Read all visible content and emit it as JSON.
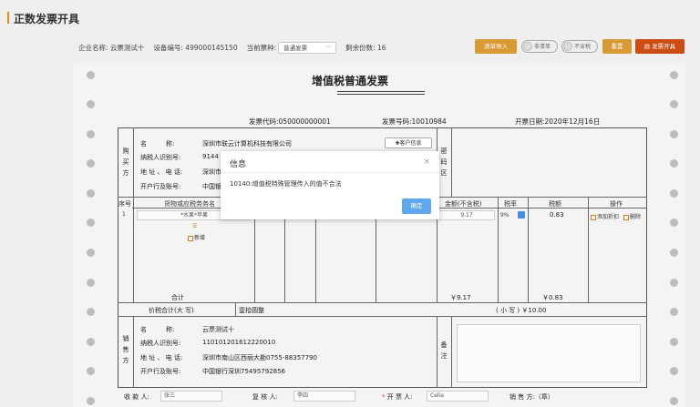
{
  "page_title": "正数发票开具",
  "toolbar": {
    "company_label": "企业名称: 云票测试十",
    "device_label": "设备编号: 499000145150",
    "current_type_label": "当前票种:",
    "current_type_value": "普通发票",
    "remaining_label": "剩余份数: 16",
    "btn_list_import": "清单导入",
    "toggle_list": "非清单",
    "toggle_tax": "不含税",
    "btn_reset": "重置",
    "btn_issue": "发票开具"
  },
  "invoice": {
    "title": "增值税普通发票",
    "code_label": "发票代码:050000000001",
    "number_label": "发票号码:10010984",
    "date_label": "开票日期:2020年12月16日",
    "buyer_side_label": [
      "购",
      "买",
      "方"
    ],
    "buyer": {
      "name_label": "名　　　称:",
      "name_value": "深圳市联云计算机科技有限公司",
      "taxid_label": "纳税人识别号:",
      "taxid_value": "9144",
      "addr_label": "地 址 、 电 话:",
      "addr_value": "深圳市",
      "bank_label": "开户行及账号:",
      "bank_value": "中国银",
      "customer_btn": "客户信息"
    },
    "password_area_label": [
      "密",
      "码",
      "区"
    ],
    "items_header": {
      "seq": "序号",
      "goods": "货物或应税劳务名",
      "amount": "金额(不含税)",
      "rate": "税率",
      "tax": "税额",
      "action": "操作"
    },
    "item_row": {
      "seq": "1",
      "goods": "*水果*苹果",
      "amount": "9.17",
      "rate": "9%",
      "tax": "0.83",
      "add_discount": "添加折扣",
      "delete": "删除"
    },
    "add_new": "新增",
    "total_label": "合计",
    "total_amount": "￥9.17",
    "total_tax": "￥0.83",
    "price_tax_total_label": "价税合计(大 写)",
    "price_tax_total_upper": "壹拾圆整",
    "price_tax_total_lower": "( 小 写 ) ￥10.00",
    "seller_side_label": [
      "销",
      "售",
      "方"
    ],
    "seller": {
      "name_label": "名　　　称:",
      "name_value": "云票测试十",
      "taxid_label": "纳税人识别号:",
      "taxid_value": "110101201612220010",
      "addr_label": "地 址 、 电 话:",
      "addr_value": "深圳市南山区西丽大勘0755-88357790",
      "bank_label": "开户行及账号:",
      "bank_value": "中国银行深圳75495792856"
    },
    "remark_label": [
      "备",
      "注"
    ],
    "footer": {
      "payee_label": "收 款 人:",
      "payee_value": "张三",
      "reviewer_label": "复 核 人:",
      "reviewer_value": "李四",
      "issuer_label": "开 票 人:",
      "issuer_value": "Celia",
      "seller_seal_label": "销 售 方:（章）"
    }
  },
  "modal": {
    "title": "信息",
    "close": "×",
    "message": "10140:增值税特殊管理传入的值不合法",
    "confirm": "确定"
  },
  "colors": {
    "accent_orange": "#d79a35",
    "issue_red": "#cc4d14",
    "confirm_blue": "#5fa8ee"
  }
}
